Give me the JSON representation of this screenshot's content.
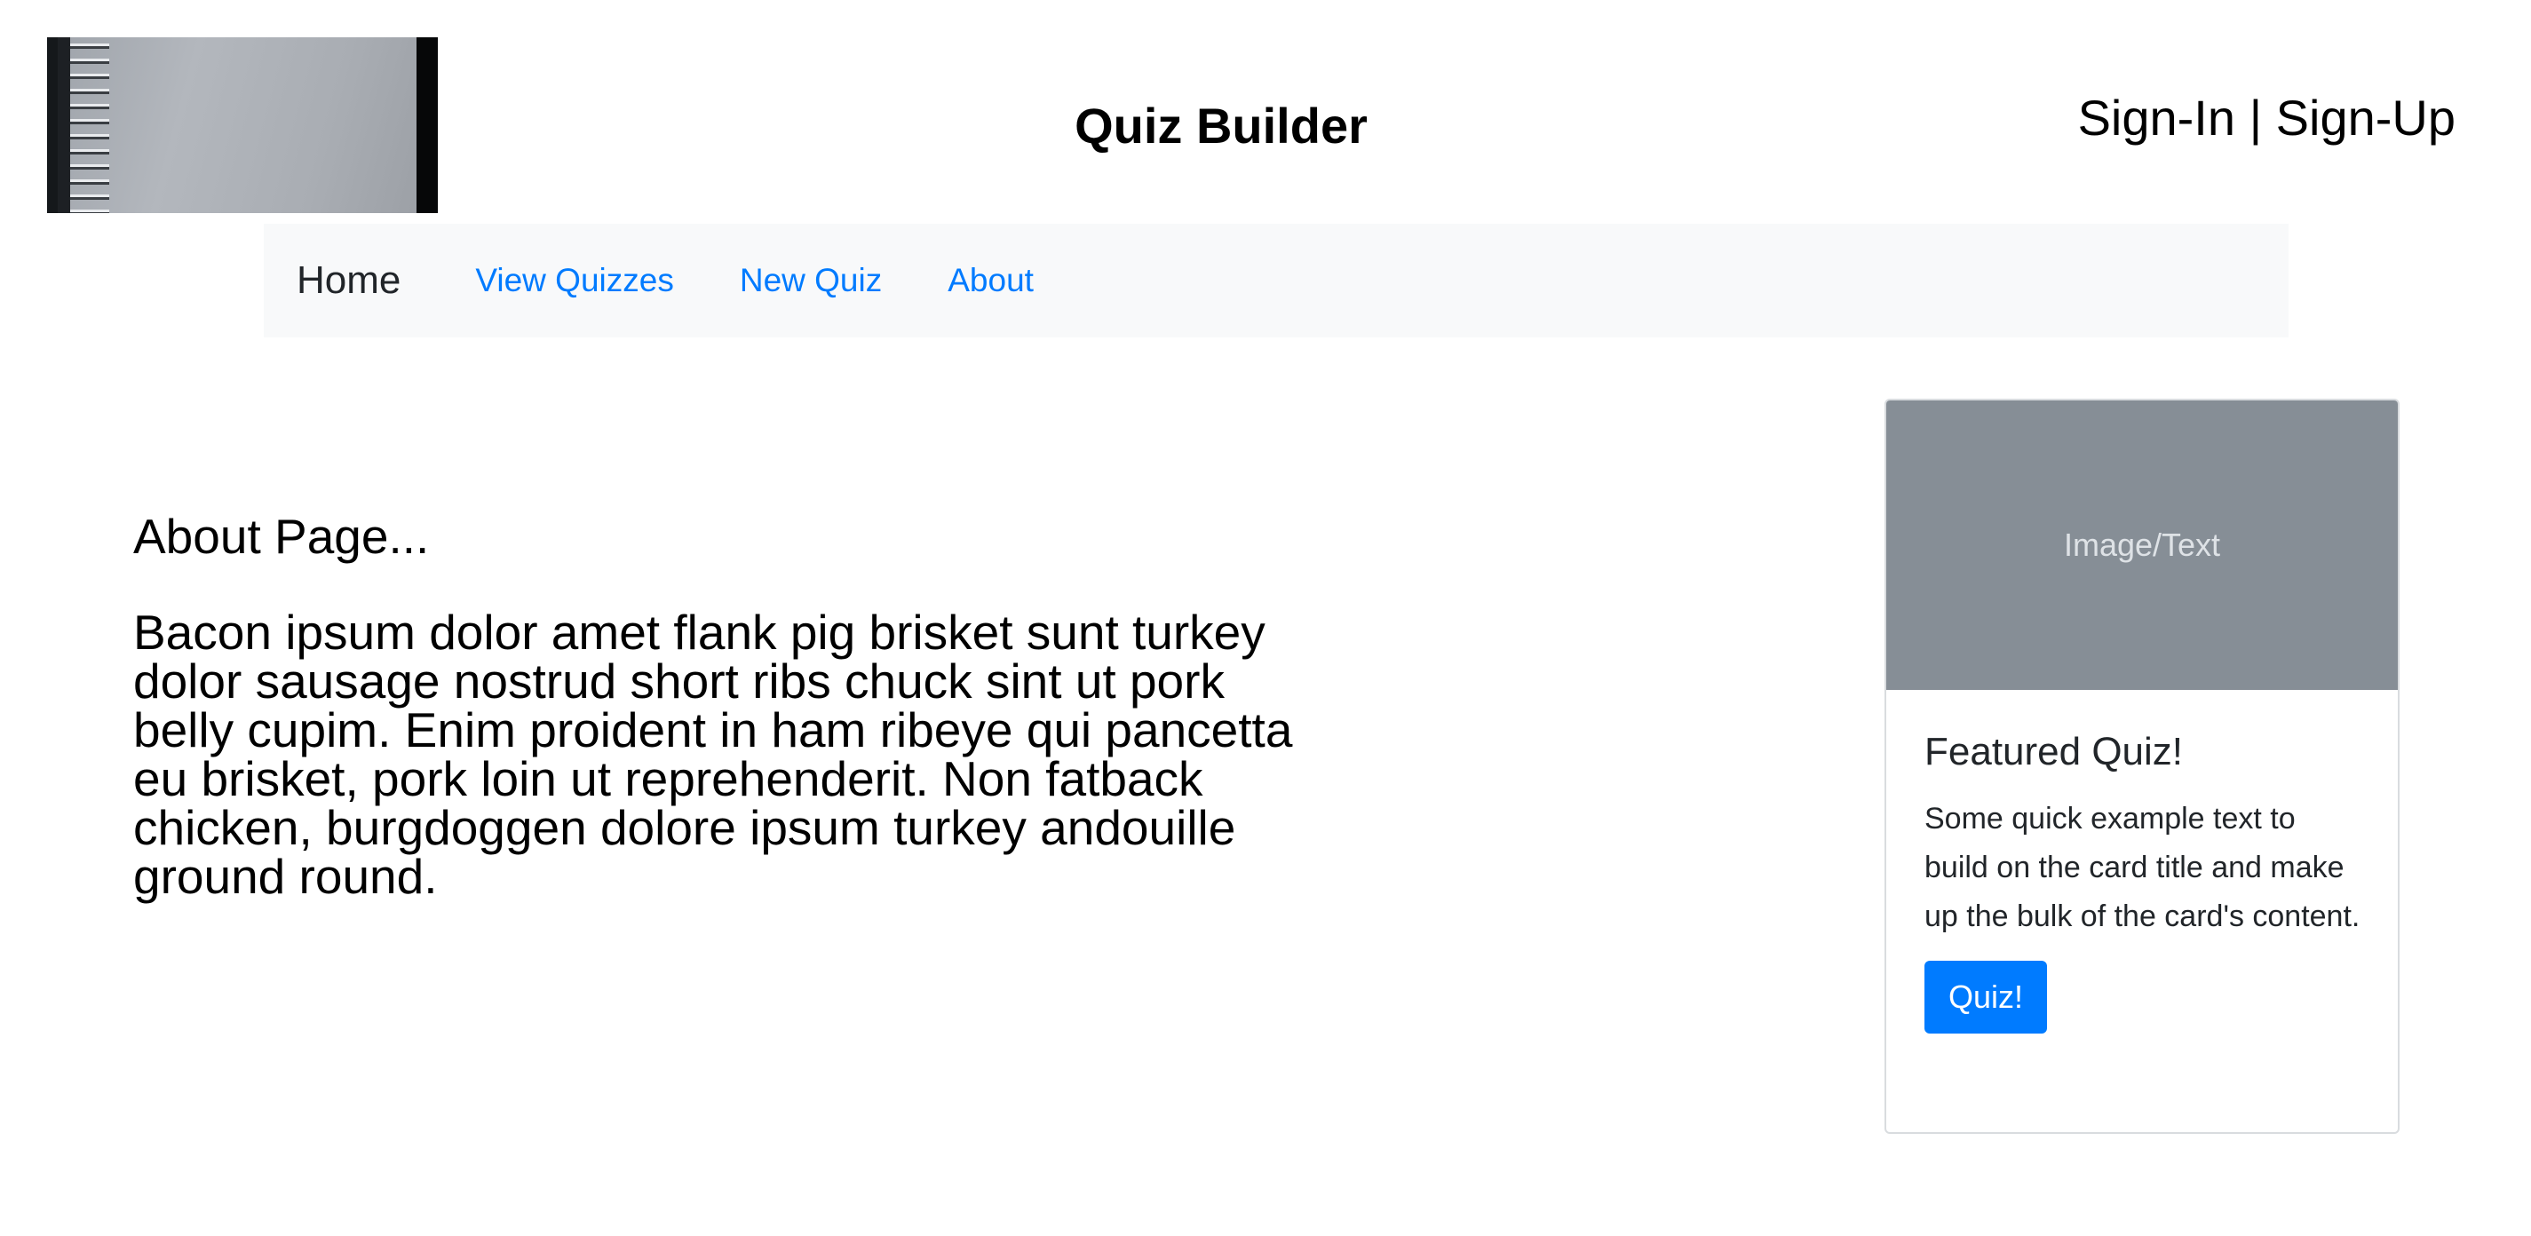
{
  "header": {
    "title": "Quiz Builder",
    "auth": {
      "sign_in": "Sign-In",
      "separator": "|",
      "sign_up": "Sign-Up"
    }
  },
  "nav": {
    "brand": "Home",
    "links": [
      "View Quizzes",
      "New Quiz",
      "About"
    ]
  },
  "main": {
    "heading": "About Page...",
    "body": "Bacon ipsum dolor amet flank pig brisket sunt turkey dolor sausage nostrud short ribs chuck sint ut pork belly cupim. Enim proident in ham ribeye qui pancetta eu brisket, pork loin ut reprehenderit. Non fatback chicken, burgdoggen dolore ipsum turkey andouille ground round."
  },
  "card": {
    "image_placeholder": "Image/Text",
    "title": "Featured Quiz!",
    "text": "Some quick example text to build on the card title and make up the bulk of the card's content.",
    "button": "Quiz!"
  },
  "colors": {
    "link": "#007bff",
    "navbar_bg": "#f8f9fa",
    "card_image_bg": "#868e96",
    "button_bg": "#007bff"
  }
}
